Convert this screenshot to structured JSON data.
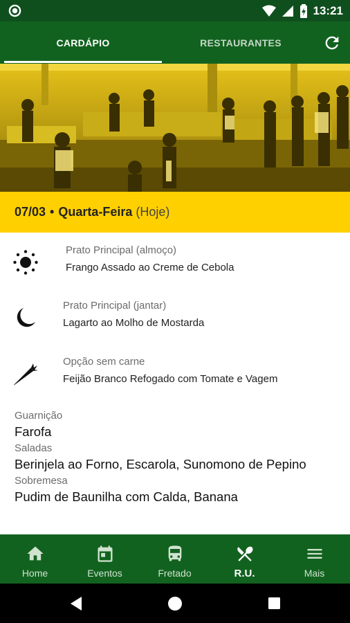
{
  "status_bar": {
    "time": "13:21"
  },
  "tabs": [
    {
      "label": "CARDÁPIO",
      "selected": true
    },
    {
      "label": "RESTAURANTES",
      "selected": false
    }
  ],
  "date_bar": {
    "date": "07/03",
    "separator": "•",
    "weekday": "Quarta-Feira",
    "today": "(Hoje)"
  },
  "meals": [
    {
      "icon": "sun-icon",
      "label": "Prato Principal (almoço)",
      "value": "Frango Assado ao Creme de Cebola"
    },
    {
      "icon": "moon-icon",
      "label": "Prato Principal (jantar)",
      "value": "Lagarto ao Molho de Mostarda"
    },
    {
      "icon": "carrot-icon",
      "label": "Opção sem carne",
      "value": "Feijão Branco Refogado com Tomate e Vagem"
    }
  ],
  "extras": [
    {
      "label": "Guarnição",
      "value": "Farofa"
    },
    {
      "label": "Saladas",
      "value": "Berinjela ao Forno, Escarola, Sunomono de Pepino"
    },
    {
      "label": "Sobremesa",
      "value": "Pudim de Baunilha com Calda, Banana"
    }
  ],
  "bottom_nav": [
    {
      "icon": "home-icon",
      "label": "Home",
      "active": false
    },
    {
      "icon": "calendar-icon",
      "label": "Eventos",
      "active": false
    },
    {
      "icon": "bus-icon",
      "label": "Fretado",
      "active": false
    },
    {
      "icon": "fork-knife-icon",
      "label": "R.U.",
      "active": true
    },
    {
      "icon": "menu-icon",
      "label": "Mais",
      "active": false
    }
  ],
  "colors": {
    "status_bar": "#0f4f1e",
    "app_bar": "#12621f",
    "date_bar": "#ffd000",
    "hero_tint": "#e8c400"
  }
}
